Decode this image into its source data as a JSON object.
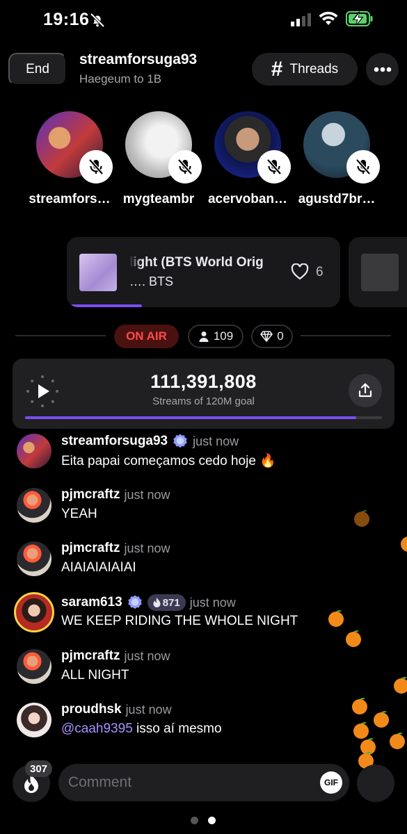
{
  "status_bar": {
    "time": "19:16"
  },
  "header": {
    "end_label": "End",
    "host": "streamforsuga93",
    "subtitle": "Haegeum to 1B",
    "threads_label": "Threads"
  },
  "speakers": [
    {
      "name": "streamfors…",
      "muted": true
    },
    {
      "name": "mygteambr",
      "muted": true
    },
    {
      "name": "acervoban…",
      "muted": true
    },
    {
      "name": "agustd7br…",
      "muted": true
    }
  ],
  "now_playing": {
    "title": "light (BTS World Orig",
    "artist": "…. BTS",
    "likes": "6"
  },
  "live": {
    "on_air": "ON AIR",
    "listeners": "109",
    "diamonds": "0"
  },
  "counter": {
    "streams": "111,391,808",
    "goal_label": "Streams of 120M goal",
    "progress": 0.928
  },
  "chat": [
    {
      "user": "streamforsuga93",
      "verified": true,
      "time": "just now",
      "text": "Eita papai começamos cedo hoje 🔥"
    },
    {
      "user": "pjmcraftz",
      "time": "just now",
      "text": "YEAH"
    },
    {
      "user": "pjmcraftz",
      "time": "just now",
      "text": "AIAIAIAIAIAI"
    },
    {
      "user": "saram613",
      "verified": true,
      "badge": "871",
      "time": "just now",
      "text": "WE KEEP RIDING THE WHOLE NIGHT"
    },
    {
      "user": "pjmcraftz",
      "time": "just now",
      "text": "ALL NIGHT"
    },
    {
      "user": "proudhsk",
      "time": "just now",
      "mention": "@caah9395",
      "text": " isso aí mesmo"
    }
  ],
  "bottom": {
    "fire_count": "307",
    "comment_placeholder": "Comment",
    "gif_label": "GIF"
  },
  "colors": {
    "accent": "#7a4ef2",
    "on_air": "#ff4a4a",
    "verified": "#8f9cff"
  }
}
